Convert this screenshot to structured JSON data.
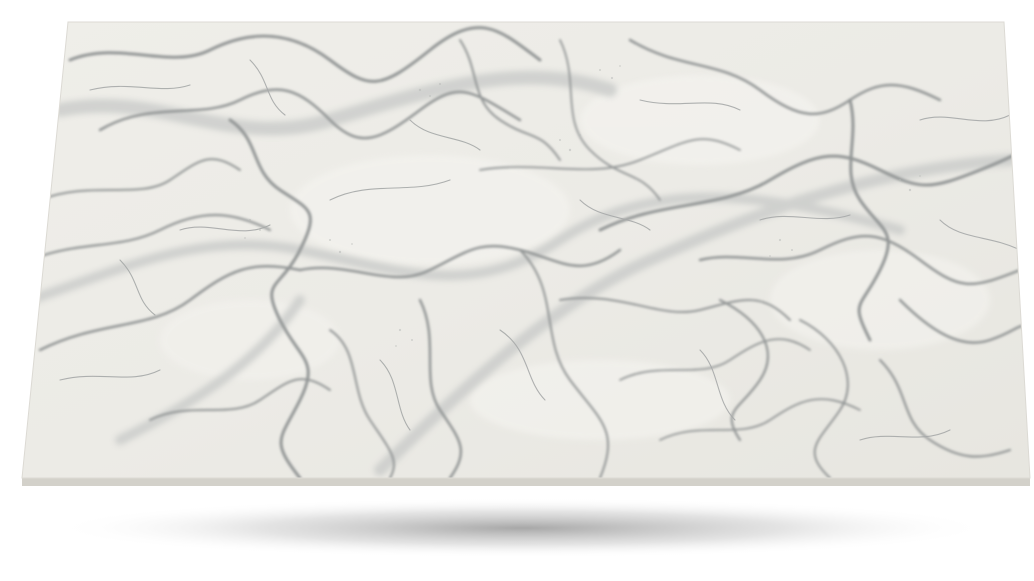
{
  "image": {
    "subject": "marble-slab",
    "colors": {
      "background": "#ffffff",
      "slab_base": "#ecebe6",
      "slab_light": "#f4f3ef",
      "slab_edge": "#cfcdc6",
      "vein_dark": "#8f9292",
      "vein_mid": "#a9acab",
      "vein_light": "#c5c7c5",
      "shadow": "#9a9a9a"
    }
  }
}
